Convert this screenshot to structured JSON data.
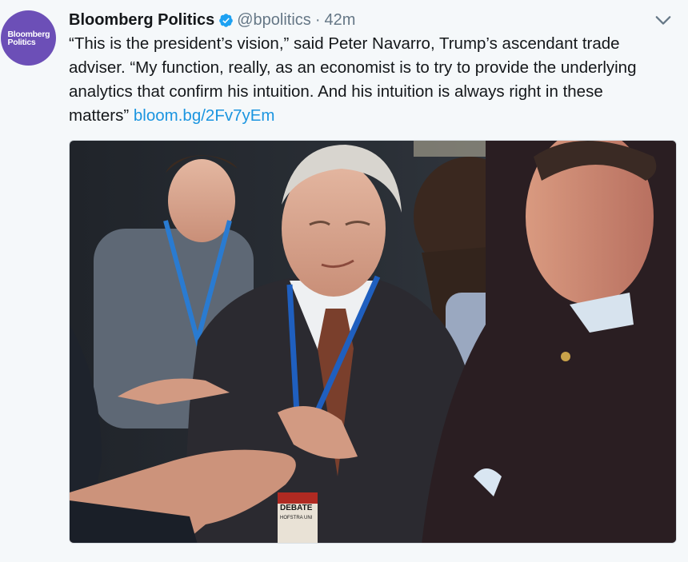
{
  "tweet": {
    "avatar_text_line1": "Bloomberg",
    "avatar_text_line2": "Politics",
    "display_name": "Bloomberg Politics",
    "handle": "@bpolitics",
    "separator": "·",
    "timestamp": "42m",
    "text": "“This is the president’s vision,” said Peter Navarro, Trump’s ascendant trade adviser. “My function, really, as an economist is to try to provide the underlying analytics that confirm his intuition. And his intuition is always right in these matters”",
    "link": "bloom.bg/2Fv7yEm",
    "photo_badge_line1": "DEBATE",
    "photo_badge_line2": "HOFSTRA UNI"
  },
  "colors": {
    "avatar_bg": "#6c4fb7",
    "verified": "#1da1f2",
    "link": "#1b95e0",
    "name": "#14171a",
    "meta": "#657786"
  },
  "icons": {
    "verified": "verified-badge-icon",
    "caret": "chevron-down-icon"
  }
}
